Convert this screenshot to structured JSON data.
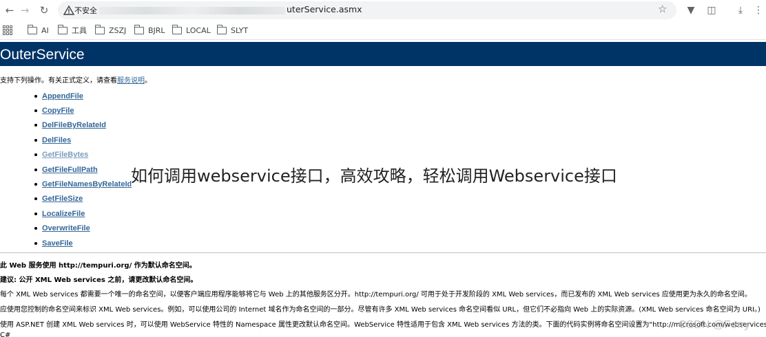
{
  "browser": {
    "insecure_label": "不安全",
    "url_visible": "uterService.asmx",
    "bookmarks": [
      "AI",
      "工具",
      "ZSZJ",
      "BJRL",
      "LOCAL",
      "SLYT"
    ]
  },
  "page": {
    "title": "OuterService",
    "intro_text": "支持下列操作。有关正式定义，请查看",
    "intro_link": "服务说明",
    "intro_end": "。",
    "operations": [
      "AppendFile",
      "CopyFile",
      "DelFileByRelateId",
      "DelFiles",
      "GetFileBytes",
      "GetFileFullPath",
      "GetFileNamesByRelateId",
      "GetFileSize",
      "LocalizeFile",
      "OverwriteFile",
      "SaveFile"
    ],
    "namespace_notice": "此 Web 服务使用 http://tempuri.org/ 作为默认命名空间。",
    "recommendation": "建议: 公开 XML Web services 之前，请更改默认命名空间。",
    "paragraph_1": "每个 XML Web services 都需要一个唯一的命名空间，以便客户端应用程序能够将它与 Web 上的其他服务区分开。http://tempuri.org/ 可用于处于开发阶段的 XML Web services，而已发布的 XML Web services 应使用更为永久的命名空间。",
    "paragraph_2": "应使用您控制的命名空间来标识 XML Web services。例如，可以使用公司的 Internet 域名作为命名空间的一部分。尽管有许多 XML Web services 命名空间看似 URL，但它们不必指向 Web 上的实际资源。(XML Web services 命名空间为 URI。)",
    "paragraph_3": "使用 ASP.NET 创建 XML Web services 时，可以使用 WebService 特性的 Namespace 属性更改默认命名空间。WebService 特性适用于包含 XML Web services 方法的类。下面的代码实例将命名空间设置为\"http://microsoft.com/webservices/\":",
    "code_start": "C#"
  },
  "overlay": {
    "watermark_title": "如何调用webservice接口，高效攻略，轻松调用Webservice接口",
    "csdn_mark": "CSDN @Ferry"
  },
  "colors": {
    "header_bg": "#003366",
    "link": "#336699"
  }
}
